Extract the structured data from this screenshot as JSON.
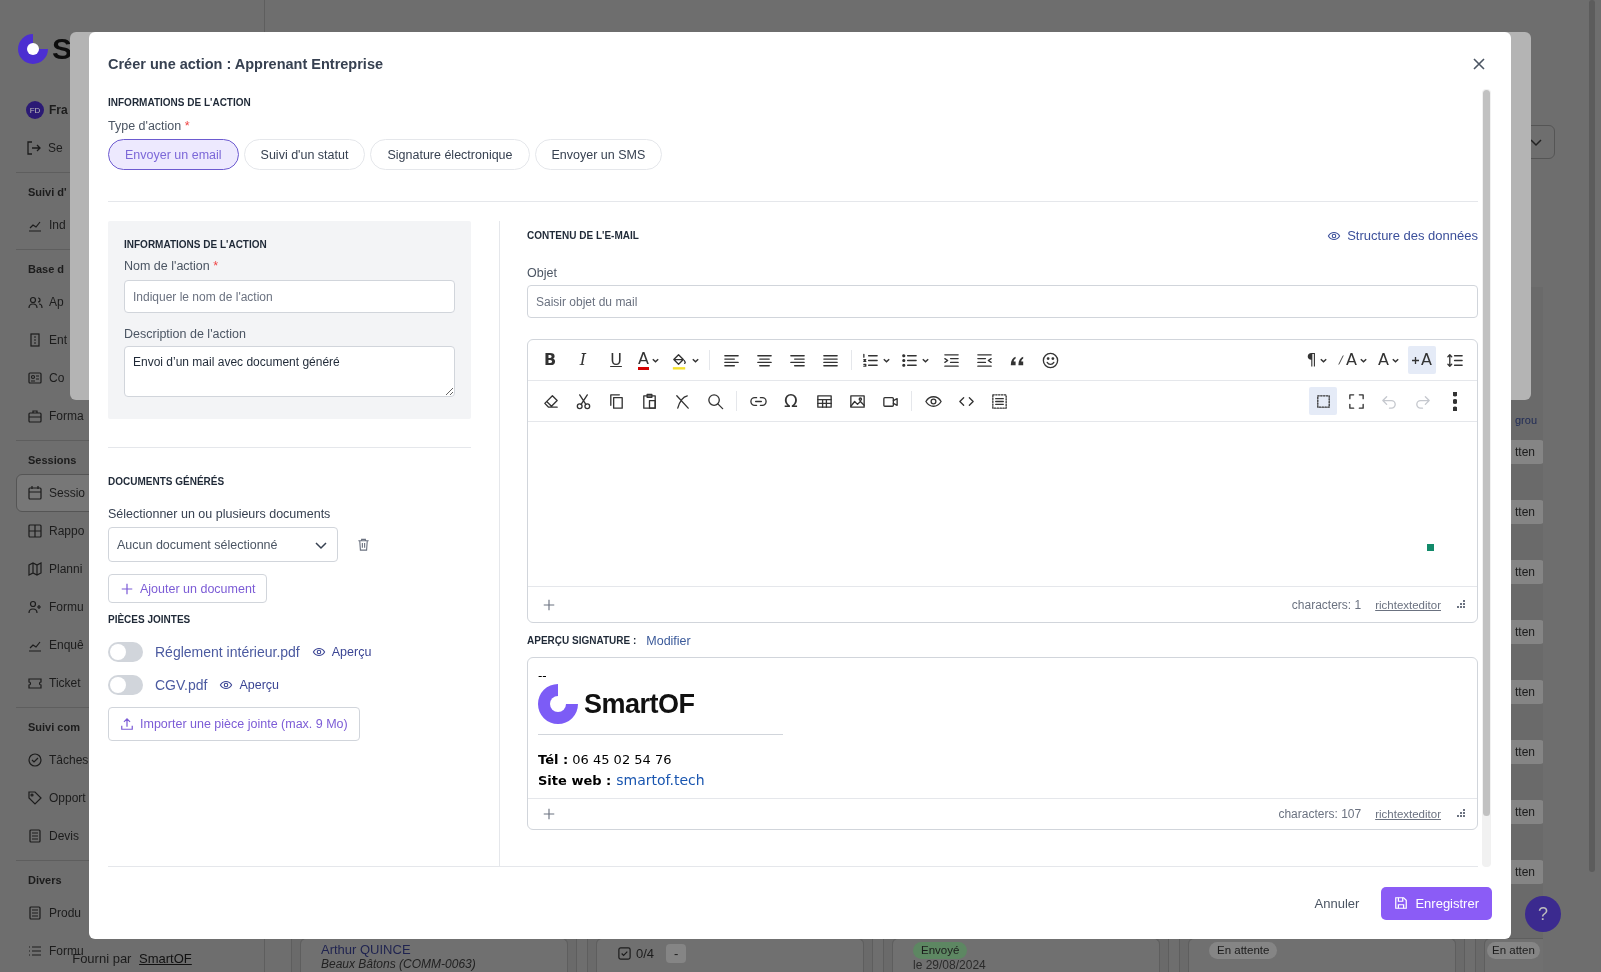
{
  "background": {
    "logo_letter": "S",
    "user_initials": "FD",
    "user_name": "Fra",
    "logout_label": "Se",
    "groups": [
      {
        "title": "Suivi d'",
        "items": [
          {
            "label": "Ind",
            "selected": false
          }
        ]
      },
      {
        "title": "Base d",
        "items": [
          {
            "label": "Ap",
            "selected": false
          },
          {
            "label": "Ent",
            "selected": false
          },
          {
            "label": "Co",
            "selected": false
          },
          {
            "label": "Forma",
            "selected": false
          }
        ]
      },
      {
        "title": "Sessions",
        "items": [
          {
            "label": "Sessio",
            "selected": true
          },
          {
            "label": "Rappo",
            "selected": false
          },
          {
            "label": "Planni",
            "selected": false
          },
          {
            "label": "Formu",
            "selected": false
          },
          {
            "label": "Enquê",
            "selected": false
          },
          {
            "label": "Ticket",
            "selected": false
          }
        ]
      },
      {
        "title": "Suivi com",
        "items": [
          {
            "label": "Tâches",
            "selected": false
          },
          {
            "label": "Opport",
            "selected": false
          },
          {
            "label": "Devis",
            "selected": false
          }
        ]
      },
      {
        "title": "Divers",
        "items": [
          {
            "label": "Produ",
            "selected": false
          },
          {
            "label": "Formu",
            "selected": false
          }
        ]
      }
    ],
    "footer_text": "Fourni par",
    "footer_link": "SmartOF",
    "column_label": "grou",
    "column_badges": [
      "tten",
      "tten",
      "tten",
      "tten",
      "tten",
      "tten",
      "tten",
      "tten"
    ],
    "cards": [
      {
        "kind": "learner",
        "title": "Arthur QUINCE",
        "subtitle": "Beaux Bâtons (COMM-0063)"
      },
      {
        "kind": "tasks",
        "progress": "0/4",
        "tag": "-"
      },
      {
        "kind": "status",
        "status": "Envoyé",
        "color": "#5d8762",
        "date": "le 29/08/2024"
      },
      {
        "kind": "status",
        "status": "En attente",
        "color": "#858585"
      },
      {
        "kind": "status",
        "status": "En atten",
        "color": "#858585"
      }
    ],
    "help": "?"
  },
  "dialog": {
    "title": "Créer une action : Apprenant Entreprise",
    "section": "INFORMATIONS DE L'ACTION",
    "type_label": "Type d'action",
    "type_required_mark": "*",
    "types": [
      {
        "label": "Envoyer un email",
        "selected": true
      },
      {
        "label": "Suivi d'un statut",
        "selected": false
      },
      {
        "label": "Signature électronique",
        "selected": false
      },
      {
        "label": "Envoyer un SMS",
        "selected": false
      }
    ],
    "action_info": {
      "heading": "INFORMATIONS DE L'ACTION",
      "name_label": "Nom de l'action",
      "name_required_mark": "*",
      "name_placeholder": "Indiquer le nom de l'action",
      "description_label": "Description de l'action",
      "description_value": "Envoi d’un mail avec document généré"
    },
    "documents": {
      "heading": "DOCUMENTS GÉNÉRÉS",
      "select_label": "Sélectionner un ou plusieurs documents",
      "select_placeholder": "Aucun document sélectionné",
      "add_button": "Ajouter un document"
    },
    "attachments": {
      "heading": "PIÈCES JOINTES",
      "files": [
        {
          "name": "Réglement intérieur.pdf",
          "on": false,
          "preview": "Aperçu"
        },
        {
          "name": "CGV.pdf",
          "on": false,
          "preview": "Aperçu"
        }
      ],
      "import_button": "Importer une pièce jointe (max. 9 Mo)"
    },
    "email": {
      "heading": "CONTENU DE L'E-MAIL",
      "structure_link": "Structure des données",
      "subject_label": "Objet",
      "subject_placeholder": "Saisir objet du mail",
      "toolbar": [
        [
          {
            "kind": "bold",
            "label": "B",
            "dropdown": false,
            "active": false,
            "disabled": false
          },
          {
            "kind": "italic",
            "label": "I",
            "dropdown": false,
            "active": false,
            "disabled": false
          },
          {
            "kind": "underline",
            "label": "U",
            "dropdown": false,
            "active": false,
            "disabled": false
          },
          {
            "kind": "fontcolor",
            "label": "A",
            "dropdown": true,
            "active": false,
            "disabled": false
          },
          {
            "kind": "highlight",
            "dropdown": true,
            "active": false,
            "disabled": false
          },
          {
            "kind": "separator"
          },
          {
            "kind": "alignleft",
            "dropdown": false,
            "active": false,
            "disabled": false
          },
          {
            "kind": "aligncenter",
            "dropdown": false,
            "active": false,
            "disabled": false
          },
          {
            "kind": "alignright",
            "dropdown": false,
            "active": false,
            "disabled": false
          },
          {
            "kind": "justify",
            "dropdown": false,
            "active": false,
            "disabled": false
          },
          {
            "kind": "separator"
          },
          {
            "kind": "orderedlist",
            "dropdown": true,
            "active": false,
            "disabled": false
          },
          {
            "kind": "bulletlist",
            "dropdown": true,
            "active": false,
            "disabled": false
          },
          {
            "kind": "indent",
            "dropdown": false,
            "active": false,
            "disabled": false
          },
          {
            "kind": "outdent",
            "dropdown": false,
            "active": false,
            "disabled": false
          },
          {
            "kind": "quote",
            "dropdown": false,
            "active": false,
            "disabled": false
          },
          {
            "kind": "emoji",
            "dropdown": false,
            "active": false,
            "disabled": false
          },
          {
            "kind": "spacer"
          },
          {
            "kind": "paragraph",
            "label": "¶",
            "dropdown": true,
            "active": false,
            "disabled": false
          },
          {
            "kind": "fontsize",
            "label": "A",
            "dropdown": true,
            "active": false,
            "disabled": false
          },
          {
            "kind": "fontname",
            "label": "A",
            "dropdown": true,
            "active": false,
            "disabled": false
          },
          {
            "kind": "addformat",
            "label": "A",
            "dropdown": false,
            "active": true,
            "disabled": false
          },
          {
            "kind": "lineheight",
            "dropdown": false,
            "active": false,
            "disabled": false
          }
        ],
        [
          {
            "kind": "eraser",
            "dropdown": false,
            "active": false,
            "disabled": false
          },
          {
            "kind": "cut",
            "dropdown": false,
            "active": false,
            "disabled": false
          },
          {
            "kind": "copy",
            "dropdown": false,
            "active": false,
            "disabled": false
          },
          {
            "kind": "paste",
            "dropdown": false,
            "active": false,
            "disabled": false
          },
          {
            "kind": "clear",
            "dropdown": false,
            "active": false,
            "disabled": false
          },
          {
            "kind": "find",
            "dropdown": false,
            "active": false,
            "disabled": false
          },
          {
            "kind": "separator"
          },
          {
            "kind": "link",
            "dropdown": false,
            "active": false,
            "disabled": false
          },
          {
            "kind": "symbol",
            "label": "Ω",
            "dropdown": false,
            "active": false,
            "disabled": false
          },
          {
            "kind": "table",
            "dropdown": false,
            "active": false,
            "disabled": false
          },
          {
            "kind": "image",
            "dropdown": false,
            "active": false,
            "disabled": false
          },
          {
            "kind": "video",
            "dropdown": false,
            "active": false,
            "disabled": false
          },
          {
            "kind": "separator"
          },
          {
            "kind": "preview",
            "dropdown": false,
            "active": false,
            "disabled": false
          },
          {
            "kind": "code",
            "dropdown": false,
            "active": false,
            "disabled": false
          },
          {
            "kind": "selectall",
            "dropdown": false,
            "active": false,
            "disabled": false
          },
          {
            "kind": "spacer"
          },
          {
            "kind": "selection",
            "dropdown": false,
            "active": true,
            "disabled": false
          },
          {
            "kind": "fullscreen",
            "dropdown": false,
            "active": false,
            "disabled": false
          },
          {
            "kind": "undo",
            "dropdown": false,
            "active": false,
            "disabled": true
          },
          {
            "kind": "redo",
            "dropdown": false,
            "active": false,
            "disabled": true
          },
          {
            "kind": "more",
            "dropdown": false,
            "active": false,
            "disabled": false
          }
        ]
      ],
      "characters": "characters: 1",
      "brand": "richtexteditor"
    },
    "signature": {
      "heading": "APERÇU SIGNATURE :",
      "edit_link": "Modifier",
      "dash": "--",
      "logo_text": "SmartOF",
      "phone": "**Tél :** 06 45 02 54 76",
      "website_label": "Site web :",
      "website": "smartof.tech",
      "characters": "characters: 107",
      "brand": "richtexteditor"
    },
    "footer": {
      "cancel": "Annuler",
      "save": "Enregistrer"
    }
  }
}
